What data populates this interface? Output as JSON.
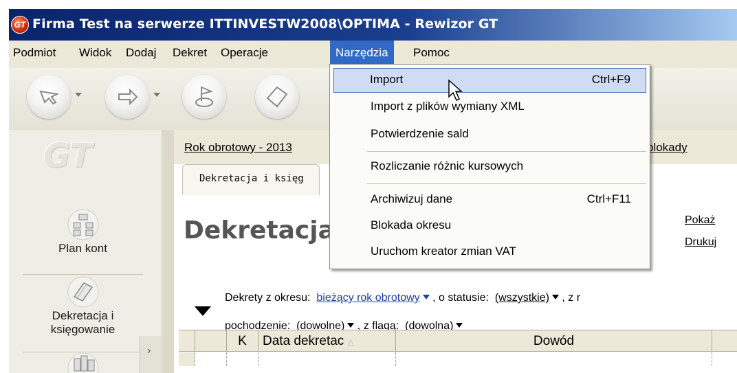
{
  "window": {
    "title": "Firma Test na serwerze ITTINVESTW2008\\OPTIMA - Rewizor GT",
    "app_icon_text": "GT"
  },
  "menubar": {
    "items": [
      "Podmiot",
      "Widok",
      "Dodaj",
      "Dekret",
      "Operacje",
      "Narzędzia",
      "Pomoc"
    ],
    "active": "Narzędzia"
  },
  "dropdown": {
    "items": [
      {
        "label": "Import",
        "shortcut": "Ctrl+F9",
        "hover": true
      },
      {
        "label": "Import z plików wymiany XML",
        "shortcut": ""
      },
      {
        "label": "Potwierdzenie sald",
        "shortcut": ""
      },
      {
        "label": "Rozliczanie różnic kursowych",
        "shortcut": ""
      },
      {
        "label": "Archiwizuj dane",
        "shortcut": "Ctrl+F11"
      },
      {
        "label": "Blokada okresu",
        "shortcut": ""
      },
      {
        "label": "Uruchom kreator zmian VAT",
        "shortcut": ""
      }
    ]
  },
  "sidepanel": {
    "logo": "GT",
    "items": [
      {
        "label": "Plan kont",
        "icon": "chart-of-accounts-icon"
      },
      {
        "label": "Dekretacja i księgowanie",
        "icon": "posting-icon"
      },
      {
        "label": "",
        "icon": "coins-icon"
      }
    ]
  },
  "content": {
    "rok_link": "Rok obrotowy - 2013",
    "blokady_link": "blokady",
    "doc_tab": "Dekretacja i księg",
    "page_title": "Dekretacja",
    "pokaz": "Pokaż",
    "drukuj": "Drukuj",
    "filter1": {
      "label1": "Dekrety z okresu:",
      "value1": "bieżący rok obrotowy",
      "label2": ", o statusie:",
      "value2": "(wszystkie)",
      "label3": ", z r"
    },
    "filter2": {
      "label1": "pochodzenie:",
      "value1": "(dowolne)",
      "label2": ", z flagą:",
      "value2": "(dowolna)"
    },
    "grid": {
      "columns": [
        "K",
        "Data dekretac",
        "Dowód"
      ]
    }
  },
  "colors": {
    "titlebar": "#0a246a",
    "menu_active": "#316ac5",
    "hover_item": "#cfdcf3",
    "link_blue": "#1c3fa3"
  }
}
